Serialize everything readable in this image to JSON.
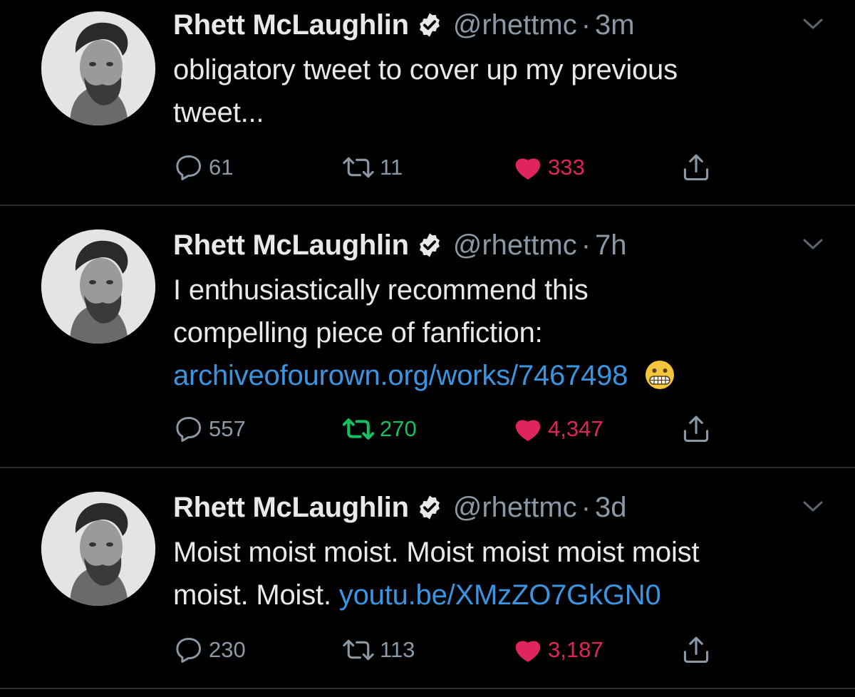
{
  "tweets": [
    {
      "name": "Rhett McLaughlin",
      "handle": "@rhettmc",
      "separator": "·",
      "time": "3m",
      "text_plain": "obligatory tweet to cover up my previous tweet...",
      "text_line1": "obligatory tweet to cover up my previous",
      "text_line2": "tweet...",
      "replies": "61",
      "retweets": "11",
      "likes": "333",
      "retweeted": false,
      "liked": true
    },
    {
      "name": "Rhett McLaughlin",
      "handle": "@rhettmc",
      "separator": "·",
      "time": "7h",
      "text_line1": "I enthusiastically recommend this",
      "text_line2": "compelling piece of fanfiction:",
      "link": "archiveofourown.org/works/7467498",
      "emoji": "grimacing-face",
      "replies": "557",
      "retweets": "270",
      "likes": "4,347",
      "retweeted": true,
      "liked": true
    },
    {
      "name": "Rhett McLaughlin",
      "handle": "@rhettmc",
      "separator": "·",
      "time": "3d",
      "text_line1": "Moist moist moist. Moist moist moist moist",
      "text_line2_prefix": "moist. Moist.",
      "link": "youtu.be/XMzZO7GkGN0",
      "replies": "230",
      "retweets": "113",
      "likes": "3,187",
      "retweeted": false,
      "liked": true
    }
  ],
  "colors": {
    "background": "#000000",
    "text": "#e7e9ea",
    "secondary": "#8b98a5",
    "link": "#3b94e0",
    "like": "#e0245e",
    "retweet": "#17bf63",
    "divider": "#2b2f33"
  },
  "icons": [
    "verified-badge-icon",
    "chevron-down-icon",
    "reply-icon",
    "retweet-icon",
    "heart-icon",
    "share-icon",
    "grimacing-face-emoji"
  ]
}
